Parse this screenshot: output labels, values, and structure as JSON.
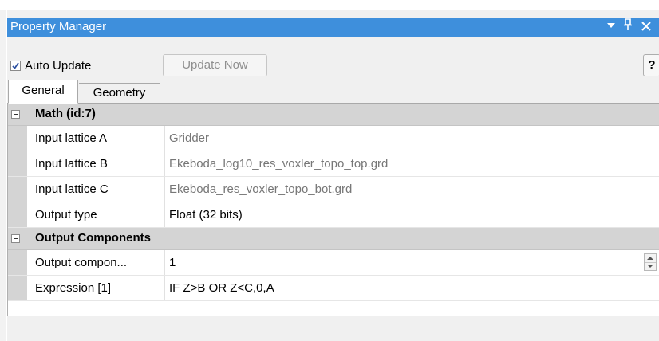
{
  "panel": {
    "title": "Property Manager",
    "controls": {
      "dropdown": "▾",
      "pin": "ᵽ",
      "close": "✕"
    }
  },
  "toolbar": {
    "auto_update_label": "Auto Update",
    "auto_update_checked": true,
    "update_now_label": "Update Now",
    "help_label": "?"
  },
  "tabs": [
    {
      "label": "General",
      "active": true
    },
    {
      "label": "Geometry",
      "active": false
    }
  ],
  "sections": [
    {
      "label": "Math (id:7)",
      "expanded": true,
      "rows": [
        {
          "name": "Input lattice A",
          "value": "Gridder"
        },
        {
          "name": "Input lattice B",
          "value": "Ekeboda_log10_res_voxler_topo_top.grd"
        },
        {
          "name": "Input lattice C",
          "value": "Ekeboda_res_voxler_topo_bot.grd"
        },
        {
          "name": "Output type",
          "value": "Float (32 bits)"
        }
      ]
    },
    {
      "label": "Output Components",
      "expanded": true,
      "rows": [
        {
          "name": "Output compon...",
          "value": "1"
        },
        {
          "name": "Expression [1]",
          "value": "IF Z>B OR Z<C,0,A"
        }
      ]
    }
  ],
  "colors": {
    "titlebar": "#3e8fdc",
    "category_bg": "#d4d4d4",
    "panel_bg": "#f0f0f0",
    "muted_text": "#777777"
  }
}
